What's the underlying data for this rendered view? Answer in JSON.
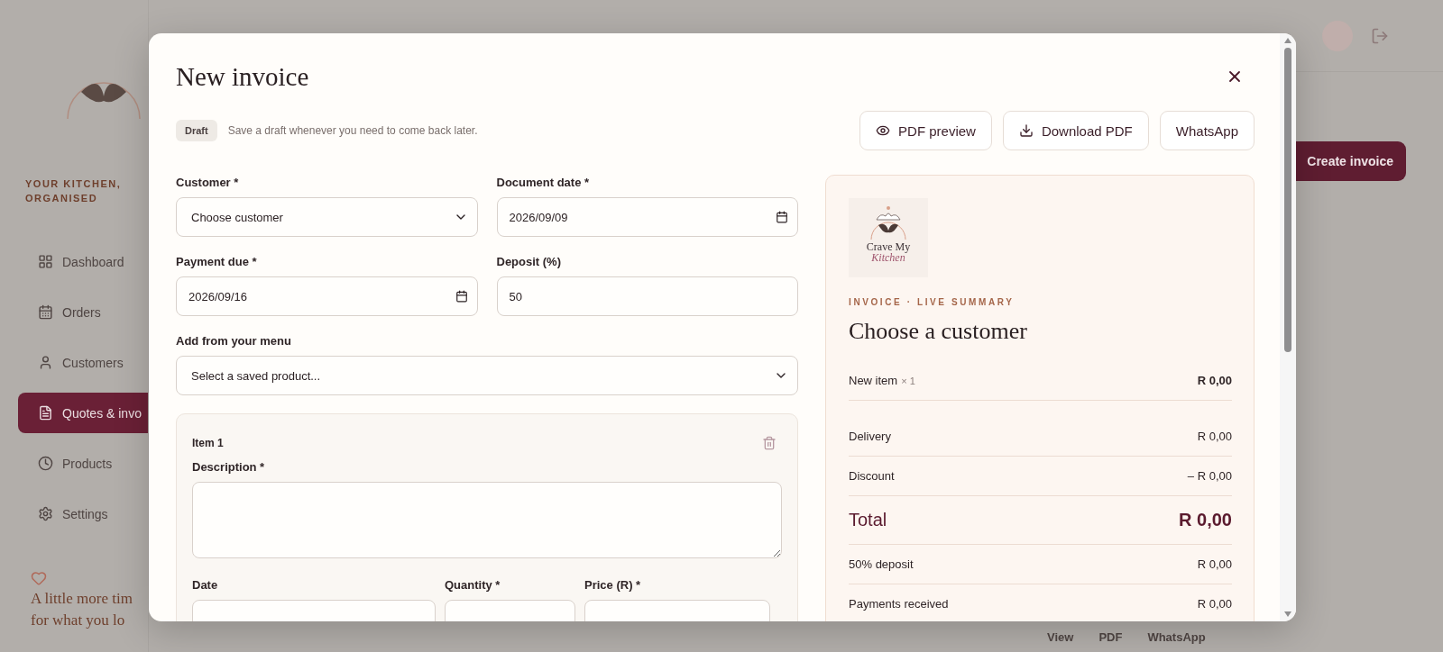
{
  "background": {
    "sidebar": {
      "tagline": "YOUR KITCHEN, ORGANISED",
      "nav": [
        {
          "label": "Dashboard",
          "selected": false
        },
        {
          "label": "Orders",
          "selected": false
        },
        {
          "label": "Customers",
          "selected": false
        },
        {
          "label": "Quotes & invo",
          "selected": true
        },
        {
          "label": "Products",
          "selected": false
        },
        {
          "label": "Settings",
          "selected": false
        }
      ],
      "note": [
        "A little more tim",
        "for what you lo"
      ]
    },
    "create_button": "Create invoice",
    "row_actions": [
      "View",
      "PDF",
      "WhatsApp"
    ]
  },
  "modal": {
    "title": "New invoice",
    "status_badge": "Draft",
    "hint": "Save a draft whenever you need to come back later.",
    "actions": [
      {
        "label": "PDF preview",
        "kind": "preview"
      },
      {
        "label": "Download PDF",
        "kind": "download"
      },
      {
        "label": "WhatsApp",
        "kind": "share"
      }
    ],
    "fields": [
      {
        "label": "Customer *",
        "value": "Choose customer",
        "kind": "select"
      },
      {
        "label": "Document date *",
        "value": "2026/09/09",
        "kind": "date"
      },
      {
        "label": "Payment due *",
        "value": "2026/09/16",
        "kind": "date"
      },
      {
        "label": "Deposit (%)",
        "value": "50",
        "kind": "number"
      }
    ],
    "menu_picker": {
      "label": "Add from your menu",
      "value": "Select a saved product..."
    },
    "items": [
      {
        "title": "Item 1",
        "description_label": "Description *",
        "date_label": "Date",
        "quantity_label": "Quantity *",
        "price_label": "Price (R) *"
      }
    ],
    "summary": {
      "logo": [
        "Crave My",
        "Kitchen"
      ],
      "eyebrow": "INVOICE · LIVE SUMMARY",
      "heading": "Choose a customer",
      "lines": [
        {
          "kind": "item",
          "label": "New item",
          "qty": "× 1",
          "amount": "R 0,00"
        },
        {
          "kind": "plain",
          "label": "Delivery",
          "amount": "R 0,00"
        },
        {
          "kind": "plain",
          "label": "Discount",
          "amount": "– R 0,00"
        },
        {
          "kind": "total",
          "label": "Total",
          "amount": "R 0,00"
        },
        {
          "kind": "plain",
          "label": "50% deposit",
          "amount": "R 0,00"
        },
        {
          "kind": "plain",
          "label": "Payments received",
          "amount": "R 0,00"
        }
      ]
    }
  }
}
